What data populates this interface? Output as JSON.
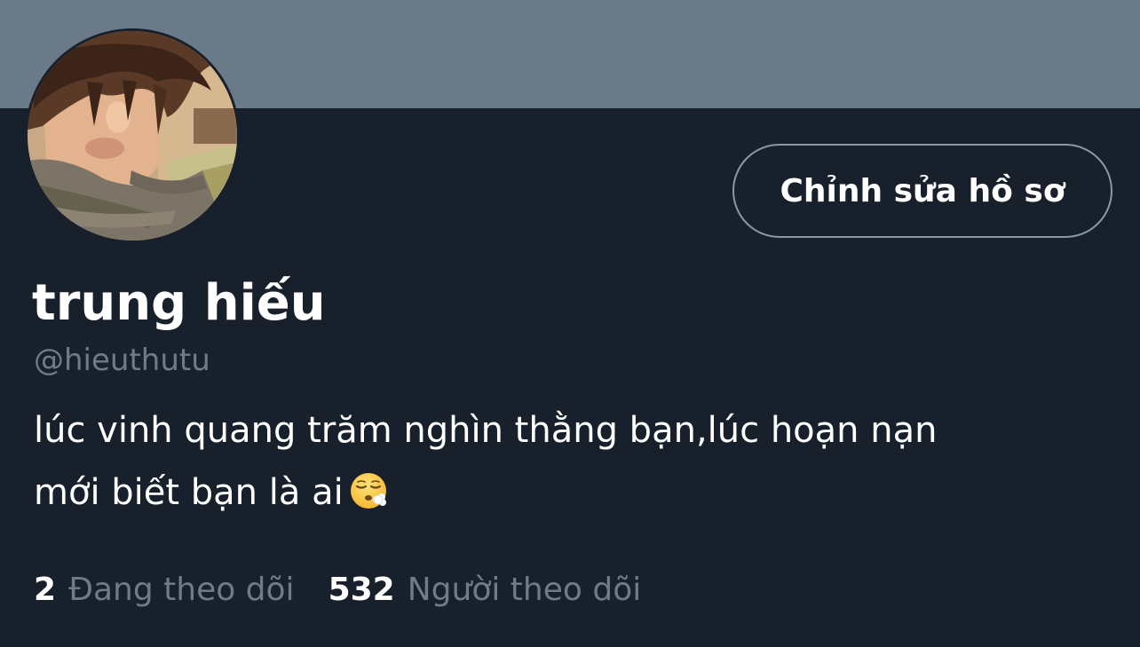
{
  "colors": {
    "background": "#17202b",
    "banner": "#6b7a88",
    "text_primary": "#ffffff",
    "text_secondary": "#6e7c89",
    "button_border": "#8899a6"
  },
  "profile": {
    "display_name": "trung hiếu",
    "handle": "@hieuthutu",
    "bio_line_1": "lúc vinh quang trăm nghìn thằng bạn,lúc hoạn nạn",
    "bio_line_2": "mới biết bạn là ai",
    "bio_emoji": "face-exhaling-emoji",
    "avatar_icon": "profile-photo"
  },
  "actions": {
    "edit_profile_label": "Chỉnh sửa hồ sơ"
  },
  "stats": {
    "following_count": "2",
    "following_label": "Đang theo dõi",
    "followers_count": "532",
    "followers_label": "Người theo dõi"
  }
}
